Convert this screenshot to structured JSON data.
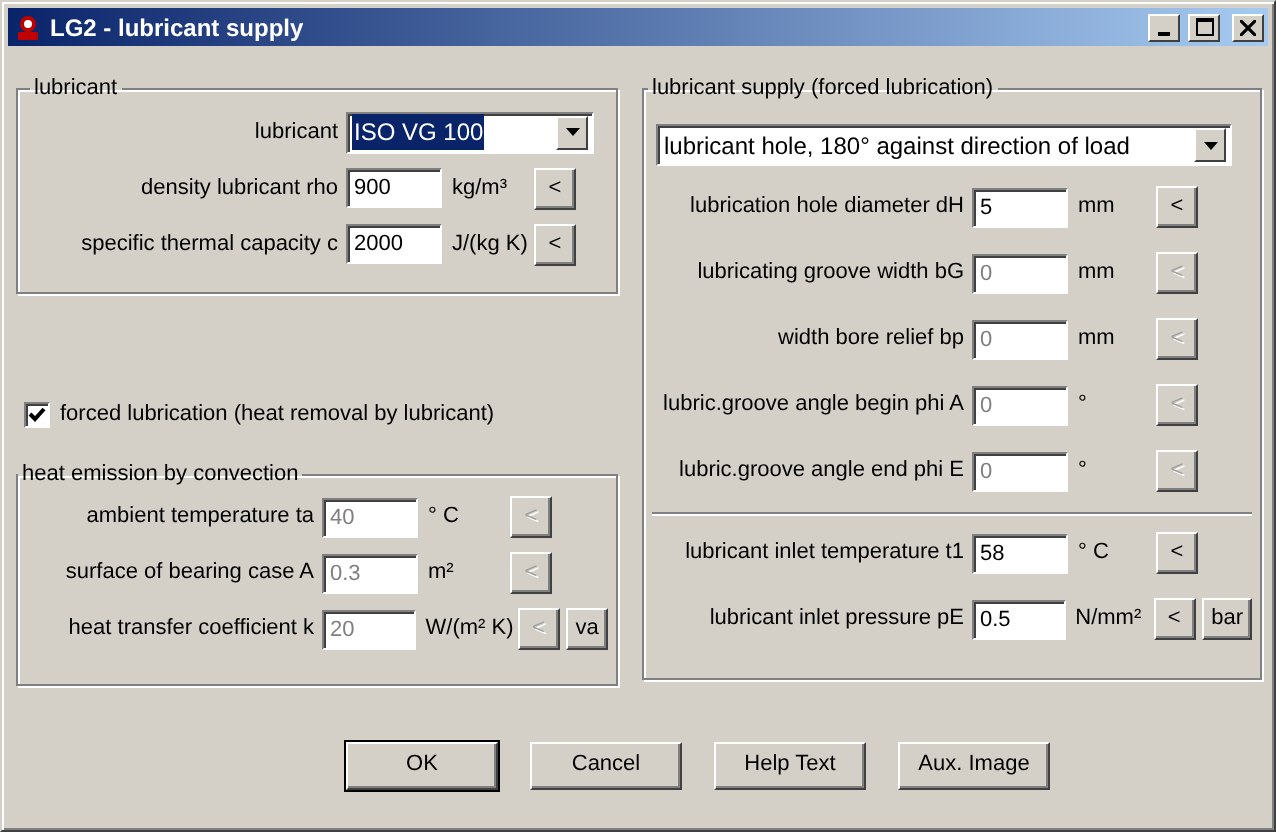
{
  "window": {
    "title": "LG2 - lubricant supply"
  },
  "lubricant_group": {
    "caption": "lubricant",
    "combo": {
      "label": "lubricant",
      "value": "ISO VG 100"
    },
    "rows": [
      {
        "label": "density lubricant rho",
        "value": "900",
        "unit": "kg/m³",
        "disabled": false,
        "buttons": [
          {
            "label": "<",
            "disabled": false
          }
        ]
      },
      {
        "label": "specific thermal capacity c",
        "value": "2000",
        "unit": "J/(kg K)",
        "disabled": false,
        "buttons": [
          {
            "label": "<",
            "disabled": false
          }
        ]
      }
    ]
  },
  "forced_lubrication": {
    "label": "forced lubrication (heat removal by lubricant)",
    "checked": true
  },
  "convection_group": {
    "caption": "heat emission by convection",
    "rows": [
      {
        "label": "ambient temperature ta",
        "value": "40",
        "unit": "° C",
        "disabled": true,
        "buttons": [
          {
            "label": "<",
            "disabled": true
          }
        ]
      },
      {
        "label": "surface of bearing case A",
        "value": "0.3",
        "unit": "m²",
        "disabled": true,
        "buttons": [
          {
            "label": "<",
            "disabled": true
          }
        ]
      },
      {
        "label": "heat transfer coefficient k",
        "value": "20",
        "unit": "W/(m² K)",
        "disabled": true,
        "buttons": [
          {
            "label": "<",
            "disabled": true
          },
          {
            "label": "va",
            "disabled": false
          }
        ]
      }
    ]
  },
  "supply_group": {
    "caption": "lubricant supply (forced lubrication)",
    "combo": {
      "value": "lubricant hole, 180° against direction of load"
    },
    "rows": [
      {
        "label": "lubrication hole diameter dH",
        "value": "5",
        "unit": "mm",
        "disabled": false,
        "buttons": [
          {
            "label": "<",
            "disabled": false
          }
        ]
      },
      {
        "label": "lubricating groove width bG",
        "value": "0",
        "unit": "mm",
        "disabled": true,
        "buttons": [
          {
            "label": "<",
            "disabled": true
          }
        ]
      },
      {
        "label": "width bore relief bp",
        "value": "0",
        "unit": "mm",
        "disabled": true,
        "buttons": [
          {
            "label": "<",
            "disabled": true
          }
        ]
      },
      {
        "label": "lubric.groove angle begin phi A",
        "value": "0",
        "unit": "°",
        "disabled": true,
        "buttons": [
          {
            "label": "<",
            "disabled": true
          }
        ]
      },
      {
        "label": "lubric.groove angle end phi E",
        "value": "0",
        "unit": "°",
        "disabled": true,
        "buttons": [
          {
            "label": "<",
            "disabled": true
          }
        ]
      }
    ],
    "rows_after_separator": [
      {
        "label": "lubricant inlet temperature t1",
        "value": "58",
        "unit": "° C",
        "disabled": false,
        "buttons": [
          {
            "label": "<",
            "disabled": false
          }
        ]
      },
      {
        "label": "lubricant inlet pressure pE",
        "value": "0.5",
        "unit": "N/mm²",
        "disabled": false,
        "buttons": [
          {
            "label": "<",
            "disabled": false
          },
          {
            "label": "bar",
            "disabled": false
          }
        ]
      }
    ]
  },
  "buttons": [
    {
      "label": "OK",
      "default": true
    },
    {
      "label": "Cancel",
      "default": false
    },
    {
      "label": "Help Text",
      "default": false
    },
    {
      "label": "Aux. Image",
      "default": false
    }
  ]
}
